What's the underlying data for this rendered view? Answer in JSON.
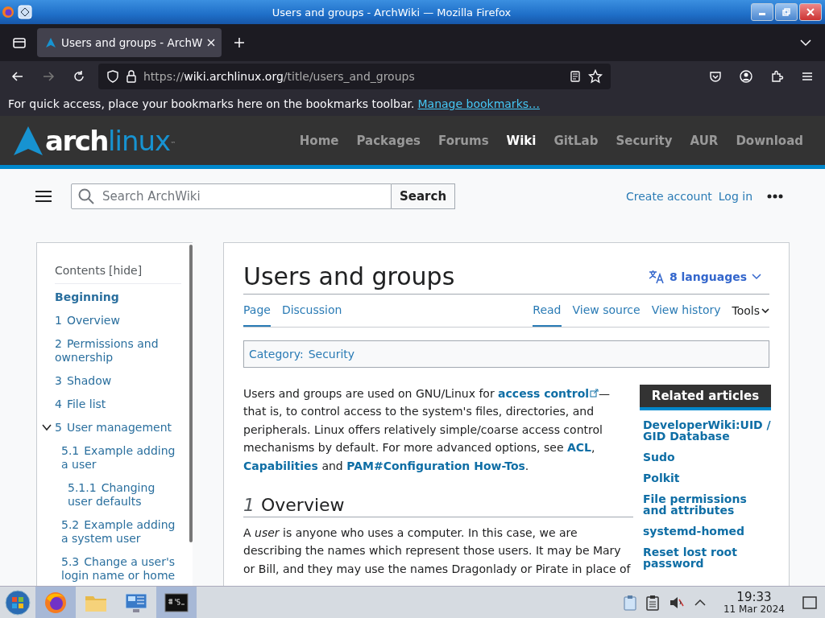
{
  "window": {
    "title": "Users and groups - ArchWiki — Mozilla Firefox"
  },
  "tabs": [
    {
      "label": "Users and groups - ArchW",
      "selected": true
    }
  ],
  "address": {
    "scheme": "https://",
    "host": "wiki.archlinux.org",
    "path": "/title/users_and_groups"
  },
  "bookmarks_bar": {
    "message": "For quick access, place your bookmarks here on the bookmarks toolbar.",
    "link": "Manage bookmarks…"
  },
  "site": {
    "logo": {
      "part_1": "arch",
      "part_2": "linux",
      "mark": "™"
    },
    "nav": [
      {
        "label": "Home",
        "selected": false
      },
      {
        "label": "Packages",
        "selected": false
      },
      {
        "label": "Forums",
        "selected": false
      },
      {
        "label": "Wiki",
        "selected": true
      },
      {
        "label": "GitLab",
        "selected": false
      },
      {
        "label": "Security",
        "selected": false
      },
      {
        "label": "AUR",
        "selected": false
      },
      {
        "label": "Download",
        "selected": false
      }
    ]
  },
  "search": {
    "placeholder": "Search ArchWiki",
    "button": "Search"
  },
  "user_links": [
    "Create account",
    "Log in"
  ],
  "toc": {
    "title": "Contents",
    "toggle": "[hide]",
    "items": [
      {
        "label": "Beginning",
        "selected": true
      },
      {
        "number": "1",
        "label": "Overview",
        "selected": false
      },
      {
        "number": "2",
        "label": "Permissions and ownership",
        "selected": false
      },
      {
        "number": "3",
        "label": "Shadow",
        "selected": false
      },
      {
        "number": "4",
        "label": "File list",
        "selected": false
      },
      {
        "number": "5",
        "label": "User management",
        "selected": false,
        "expanded": true,
        "children": [
          {
            "number": "5.1",
            "label": "Example adding a user",
            "selected": false,
            "children": [
              {
                "number": "5.1.1",
                "label": "Changing user defaults",
                "selected": false
              }
            ]
          },
          {
            "number": "5.2",
            "label": "Example adding a system user",
            "selected": false
          },
          {
            "number": "5.3",
            "label": "Change a user's login name or home",
            "selected": false
          }
        ]
      }
    ]
  },
  "article": {
    "title": "Users and groups",
    "languages": "8 languages",
    "tabs_left": [
      {
        "label": "Page",
        "selected": true
      },
      {
        "label": "Discussion",
        "selected": false
      }
    ],
    "tabs_right": [
      {
        "label": "Read",
        "selected": true
      },
      {
        "label": "View source",
        "selected": false
      },
      {
        "label": "View history",
        "selected": false
      }
    ],
    "tools": "Tools",
    "category": {
      "label": "Category:",
      "value": "Security"
    },
    "intro": [
      {
        "kind": "text",
        "text": "Users and groups are used on GNU/Linux for "
      },
      {
        "kind": "link",
        "text": "access control",
        "external": true
      },
      {
        "kind": "text",
        "text": "— that is, to control access to the system's files, directories, and peripherals. Linux offers relatively simple/coarse access control mechanisms by default. For more advanced options, see "
      },
      {
        "kind": "link",
        "text": "ACL",
        "external": false
      },
      {
        "kind": "text",
        "text": ", "
      },
      {
        "kind": "link",
        "text": "Capabilities",
        "external": false
      },
      {
        "kind": "text",
        "text": " and "
      },
      {
        "kind": "link",
        "text": "PAM#Configuration How-Tos",
        "external": false
      },
      {
        "kind": "text",
        "text": "."
      }
    ],
    "section": {
      "number": "1",
      "title": "Overview",
      "text": "A *user* is anyone who uses a computer. In this case, we are describing the names which represent those users. It may be Mary or Bill, and they may use the names Dragonlady or Pirate in place of"
    },
    "related": {
      "title": "Related articles",
      "items": [
        "DeveloperWiki:UID / GID Database",
        "Sudo",
        "Polkit",
        "File permissions and attributes",
        "systemd-homed",
        "Reset lost root password"
      ]
    }
  },
  "taskbar": {
    "time": "19:33",
    "date": "11 Mar 2024",
    "apps": [
      {
        "kind": "firefox",
        "selected": true
      },
      {
        "kind": "folder",
        "selected": false
      },
      {
        "kind": "monitor",
        "selected": false
      },
      {
        "kind": "terminal",
        "selected": true
      }
    ]
  }
}
